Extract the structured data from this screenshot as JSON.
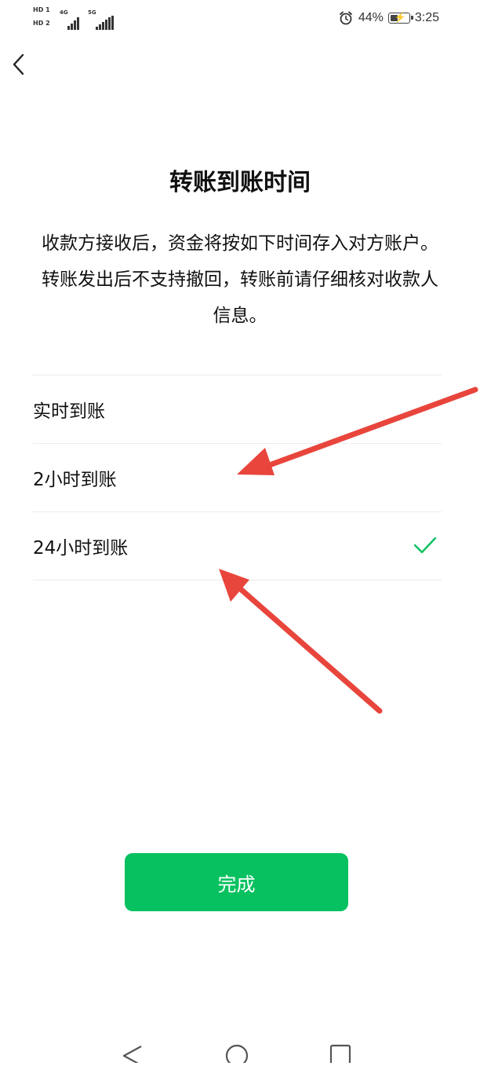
{
  "status_bar": {
    "sim1": "HD 1",
    "sim2": "HD 2",
    "net1": "4G",
    "net2": "5G",
    "battery_percent": "44%",
    "time": "3:25",
    "battery_level": 0.44
  },
  "nav": {
    "back_icon": "chevron-left-icon"
  },
  "page": {
    "title": "转账到账时间",
    "description": "收款方接收后，资金将按如下时间存入对方账户。转账发出后不支持撤回，转账前请仔细核对收款人信息。"
  },
  "options": [
    {
      "label": "实时到账",
      "selected": false
    },
    {
      "label": "2小时到账",
      "selected": false
    },
    {
      "label": "24小时到账",
      "selected": true
    }
  ],
  "done_button": {
    "label": "完成"
  },
  "colors": {
    "accent": "#07c160",
    "check": "#07c160",
    "annotation_arrow": "#e8453c"
  },
  "system_nav": {
    "back_icon": "triangle-back-icon",
    "home_icon": "circle-home-icon",
    "recents_icon": "square-recents-icon"
  }
}
